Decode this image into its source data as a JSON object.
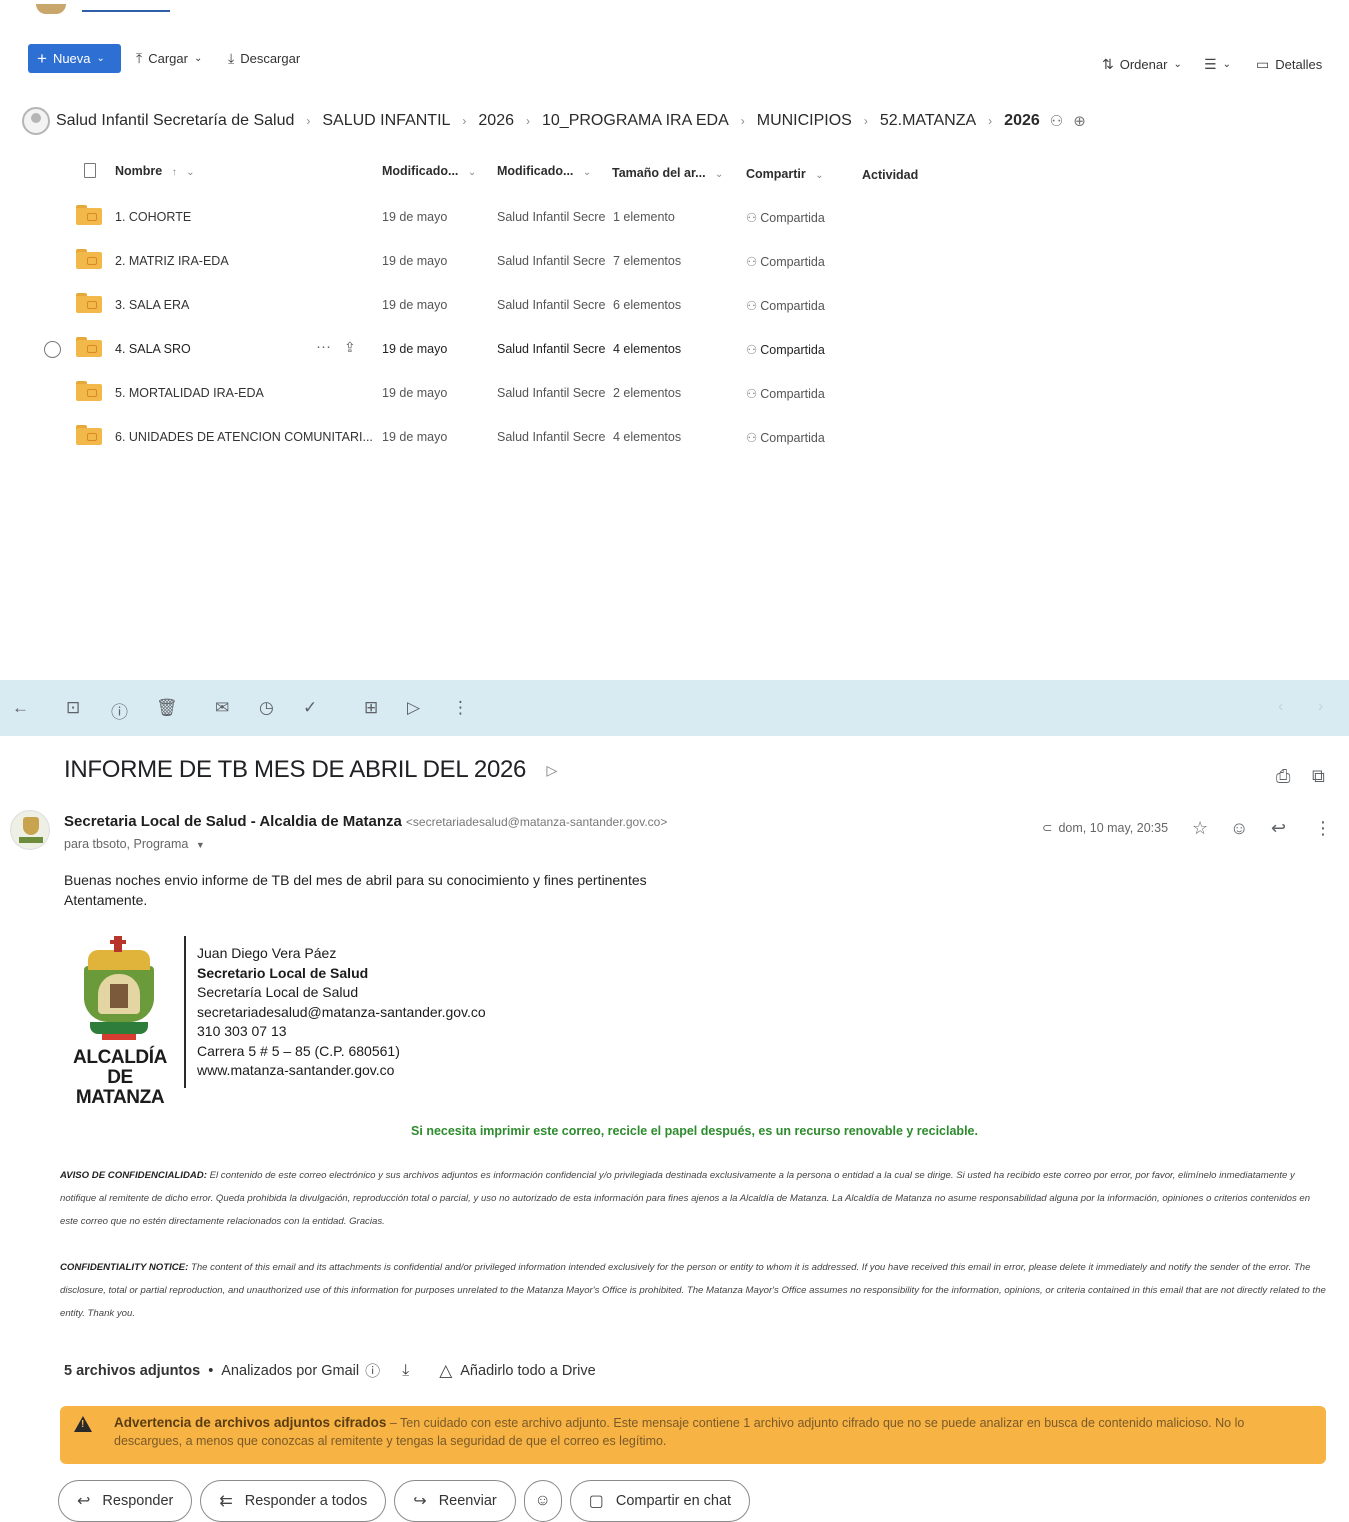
{
  "sharepoint": {
    "toolbar": {
      "new_label": "Nueva",
      "upload_label": "Cargar",
      "download_label": "Descargar",
      "sort_label": "Ordenar",
      "details_label": "Detalles"
    },
    "breadcrumb": [
      "Salud Infantil Secretaría de Salud",
      "SALUD INFANTIL",
      "2026",
      "10_PROGRAMA IRA EDA",
      "MUNICIPIOS",
      "52.MATANZA",
      "2026"
    ],
    "columns": {
      "name": "Nombre",
      "name_sort": "↑",
      "modified": "Modificado...",
      "modified_by": "Modificado...",
      "size": "Tamaño del ar...",
      "sharing": "Compartir",
      "activity": "Actividad"
    },
    "rows": [
      {
        "name": "1. COHORTE",
        "modified": "19 de mayo",
        "modified_by": "Salud Infantil Secre",
        "size": "1 elemento",
        "sharing": "Compartida"
      },
      {
        "name": "2. MATRIZ IRA-EDA",
        "modified": "19 de mayo",
        "modified_by": "Salud Infantil Secre",
        "size": "7 elementos",
        "sharing": "Compartida"
      },
      {
        "name": "3. SALA ERA",
        "modified": "19 de mayo",
        "modified_by": "Salud Infantil Secre",
        "size": "6 elementos",
        "sharing": "Compartida"
      },
      {
        "name": "4. SALA SRO",
        "modified": "19 de mayo",
        "modified_by": "Salud Infantil Secre",
        "size": "4 elementos",
        "sharing": "Compartida"
      },
      {
        "name": "5. MORTALIDAD IRA-EDA",
        "modified": "19 de mayo",
        "modified_by": "Salud Infantil Secre",
        "size": "2 elementos",
        "sharing": "Compartida"
      },
      {
        "name": "6. UNIDADES DE ATENCION COMUNITARI...",
        "modified": "19 de mayo",
        "modified_by": "Salud Infantil Secre",
        "size": "4 elementos",
        "sharing": "Compartida"
      }
    ]
  },
  "gmail": {
    "subject": "INFORME DE TB MES DE ABRIL DEL 2026",
    "sender_name": "Secretaria Local de Salud - Alcaldia de Matanza",
    "sender_email": "<secretariadesalud@matanza-santander.gov.co>",
    "recipients": "para tbsoto, Programa",
    "date": "dom, 10 may, 20:35",
    "body_line1": "Buenas noches envio informe de TB del mes de abril  para su conocimiento y fines pertinentes",
    "body_line2": "Atentamente.",
    "signature": {
      "logo_text": "ALCALDÍA DE MATANZA",
      "name": "Juan Diego Vera Páez",
      "role": "Secretario Local de Salud",
      "office": "Secretaría Local de Salud",
      "email": "secretariadesalud@matanza-santander.gov.co",
      "phone": "310 303 07 13",
      "address": "Carrera 5 # 5 – 85 (C.P. 680561)",
      "website": "www.matanza-santander.gov.co"
    },
    "eco_note": "Si necesita imprimir este correo, recicle el papel después, es un recurso renovable y reciclable.",
    "confidential_es_heading": "AVISO DE CONFIDENCIALIDAD:",
    "confidential_es": "El contenido de este correo electrónico y sus archivos adjuntos es información confidencial y/o privilegiada destinada exclusivamente a la persona o entidad a la cual se dirige. Si usted ha recibido este correo por error, por favor, elimínelo inmediatamente y notifique al remitente de dicho error. Queda prohibida la divulgación, reproducción total o parcial, y uso no autorizado de esta información para fines ajenos a la Alcaldía de Matanza. La Alcaldía de Matanza no asume responsabilidad alguna por la información, opiniones o criterios contenidos en este correo que no estén directamente relacionados con la entidad. Gracias.",
    "confidential_en_heading": "CONFIDENTIALITY NOTICE:",
    "confidential_en": "The content of this email and its attachments is confidential and/or privileged information intended exclusively for the person or entity to whom it is addressed. If you have received this email in error, please delete it immediately and notify the sender of the error. The disclosure, total or partial reproduction, and unauthorized use of this information for purposes unrelated to the Matanza Mayor's Office is prohibited. The Matanza Mayor's Office assumes no responsibility for the information, opinions, or criteria contained in this email that are not directly related to the entity. Thank you.",
    "attachments": {
      "count_label": "5 archivos adjuntos",
      "scanned_label": "Analizados por Gmail",
      "drive_label": "Añadirlo todo a Drive"
    },
    "warning": {
      "title": "Advertencia de archivos adjuntos cifrados",
      "text": "Ten cuidado con este archivo adjunto. Este mensaje contiene 1 archivo adjunto cifrado que no se puede analizar en busca de contenido malicioso. No lo descargues, a menos que conozcas al remitente y tengas la seguridad de que el correo es legítimo."
    },
    "actions": {
      "reply": "Responder",
      "reply_all": "Responder a todos",
      "forward": "Reenviar",
      "share_chat": "Compartir en chat"
    }
  },
  "colors": {
    "accent_blue": "#2d6fd2",
    "gmail_toolbar": "#d9ebf2",
    "warning": "#f7b343",
    "eco_green": "#2e8b2e",
    "folder": "#f2b94a"
  }
}
